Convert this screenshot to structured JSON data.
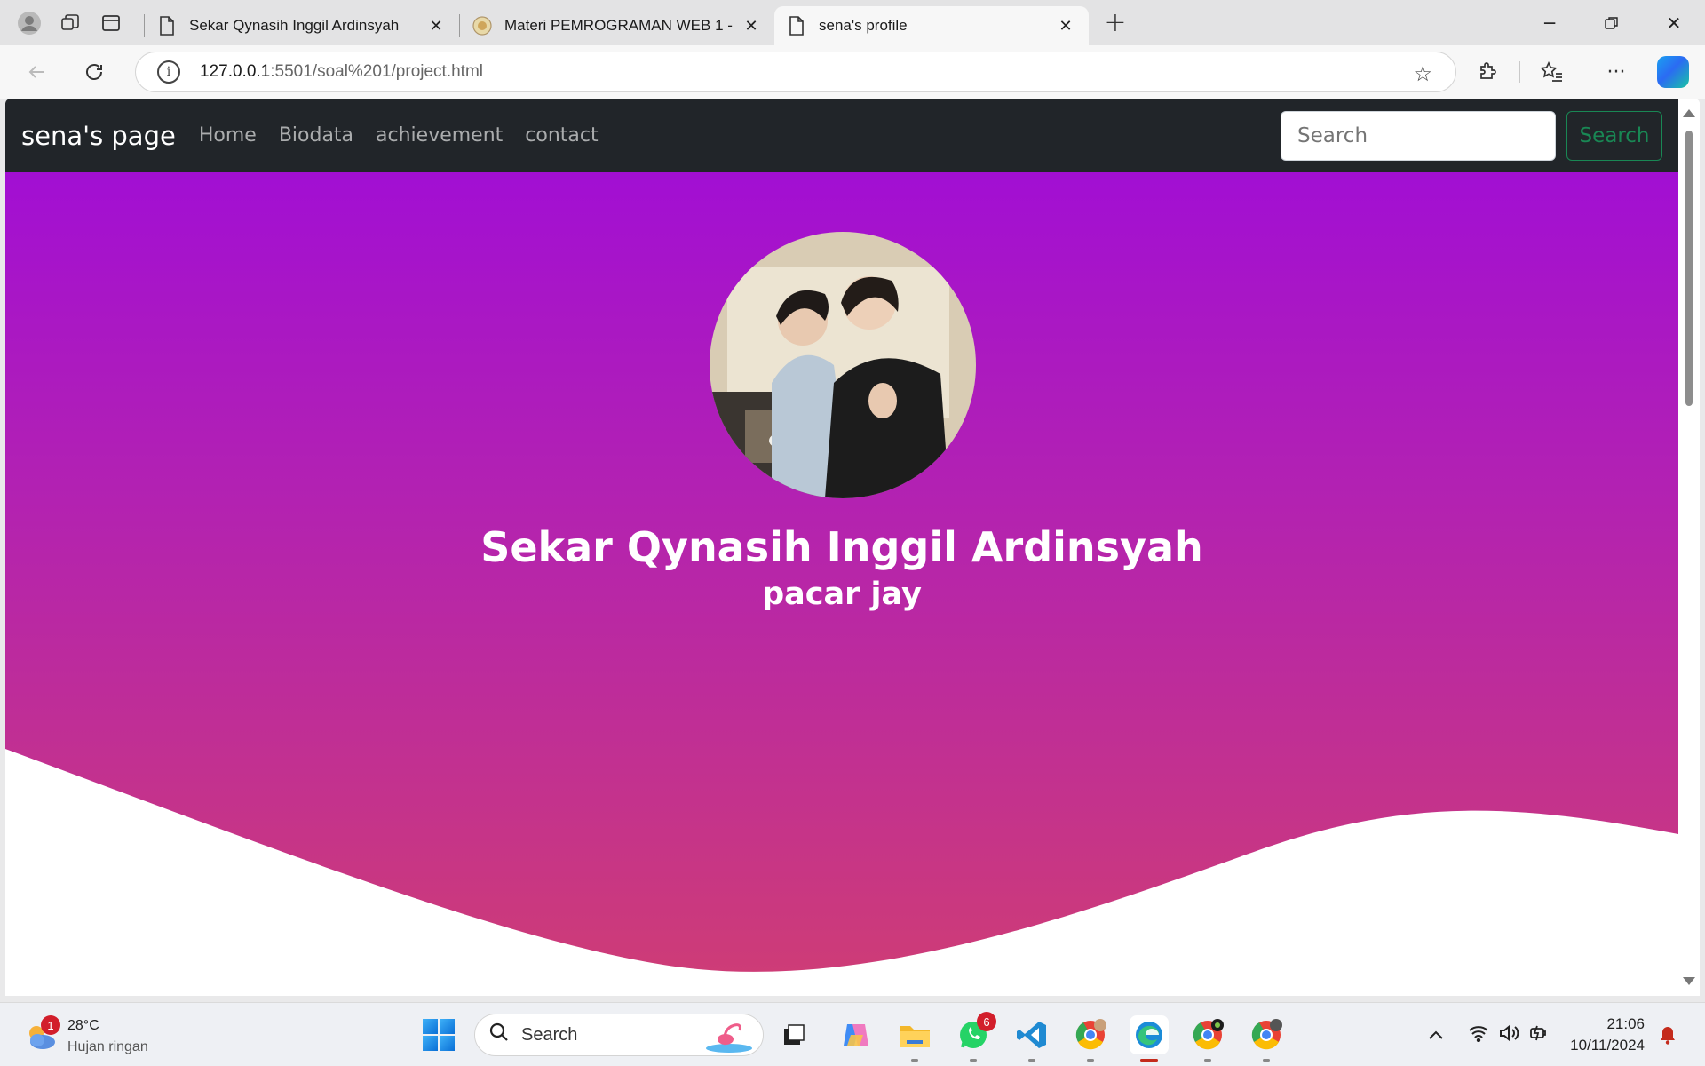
{
  "browser": {
    "tabs": [
      {
        "title": "Sekar Qynasih Inggil Ardinsyah",
        "icon": "page-icon",
        "active": false
      },
      {
        "title": "Materi PEMROGRAMAN WEB 1 -",
        "icon": "site-favicon",
        "active": false
      },
      {
        "title": "sena's profile",
        "icon": "page-icon",
        "active": true
      }
    ],
    "url_host": "127.0.0.1",
    "url_path": ":5501/soal%201/project.html"
  },
  "page": {
    "brand": "sena's page",
    "nav_links": [
      "Home",
      "Biodata",
      "achievement",
      "contact"
    ],
    "search_placeholder": "Search",
    "search_button": "Search",
    "hero_name": "Sekar Qynasih Inggil Ardinsyah",
    "hero_subtitle": "pacar jay"
  },
  "taskbar": {
    "weather_temp": "28°C",
    "weather_condition": "Hujan ringan",
    "weather_badge": "1",
    "search_label": "Search",
    "whatsapp_badge": "6",
    "time": "21:06",
    "date": "10/11/2024"
  },
  "colors": {
    "navbar": "#212529",
    "hero_top": "#a20fd3",
    "hero_bottom": "#cf3d74",
    "search_button": "#198754"
  }
}
